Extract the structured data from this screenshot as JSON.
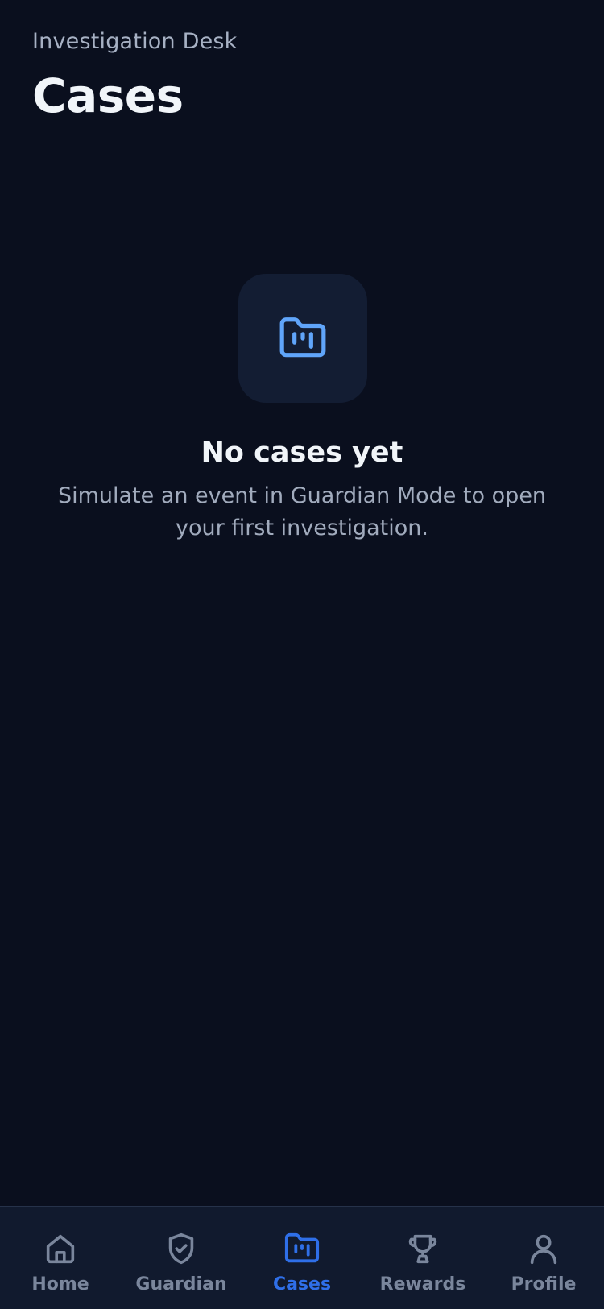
{
  "header": {
    "subtitle": "Investigation Desk",
    "title": "Cases"
  },
  "empty_state": {
    "icon": "folder-kanban-icon",
    "title": "No cases yet",
    "description": "Simulate an event in Guardian Mode to open your first investigation."
  },
  "tabbar": {
    "active": "Cases",
    "items": [
      {
        "label": "Home",
        "icon": "home-icon"
      },
      {
        "label": "Guardian",
        "icon": "shield-check-icon"
      },
      {
        "label": "Cases",
        "icon": "folder-kanban-icon"
      },
      {
        "label": "Rewards",
        "icon": "trophy-icon"
      },
      {
        "label": "Profile",
        "icon": "user-icon"
      }
    ]
  },
  "colors": {
    "background": "#0a0f1e",
    "tabbar": "#111a2e",
    "accent": "#2f6fe8",
    "icon_accent": "#60a5fa",
    "inactive": "#7a869c"
  }
}
